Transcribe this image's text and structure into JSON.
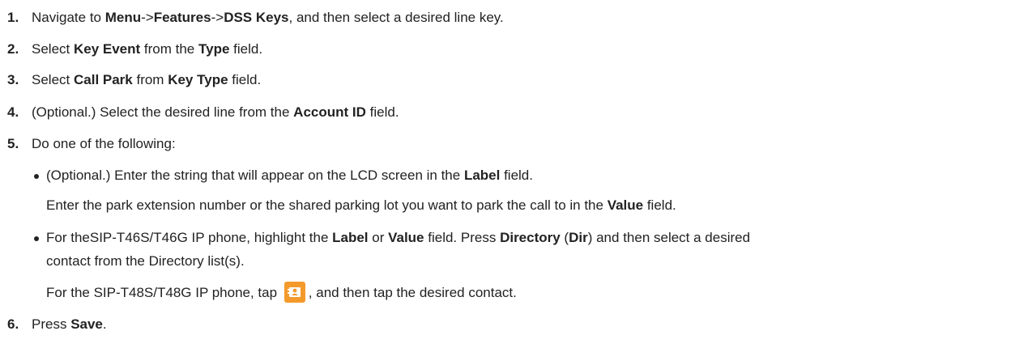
{
  "steps": [
    {
      "num": "1.",
      "parts": [
        "Navigate to ",
        "Menu",
        "->",
        "Features",
        "->",
        "DSS Keys",
        ", and then select a desired line key."
      ]
    },
    {
      "num": "2.",
      "parts": [
        "Select ",
        "Key Event",
        " from the ",
        "Type",
        " field."
      ]
    },
    {
      "num": "3.",
      "parts": [
        "Select ",
        "Call Park",
        " from ",
        "Key Type",
        " field."
      ]
    },
    {
      "num": "4.",
      "parts": [
        "(Optional.) Select the desired line from the ",
        "Account ID",
        " field."
      ]
    },
    {
      "num": "5.",
      "parts": [
        "Do one of the following:"
      ]
    },
    {
      "num": "6.",
      "parts": [
        "Press ",
        "Save",
        "."
      ]
    }
  ],
  "bullets": [
    {
      "line1": [
        "(Optional.) Enter the string that will appear on the LCD screen in the ",
        "Label",
        " field."
      ],
      "line2": [
        "Enter the park extension number or the shared parking lot you want to park the call to in the ",
        "Value",
        " field."
      ]
    },
    {
      "line1": [
        "For theSIP-T46S/T46G IP phone, highlight the ",
        "Label",
        " or ",
        "Value",
        " field. Press ",
        "Directory",
        " (",
        "Dir",
        ") and then select a desired"
      ],
      "line2": [
        "contact from the Directory list(s)."
      ],
      "line3": [
        "For the SIP-T48S/T48G IP phone, tap ",
        ", and then tap the desired contact."
      ]
    }
  ],
  "icons": {
    "contacts": "contacts-icon",
    "contacts_color": "#f39a2b"
  }
}
